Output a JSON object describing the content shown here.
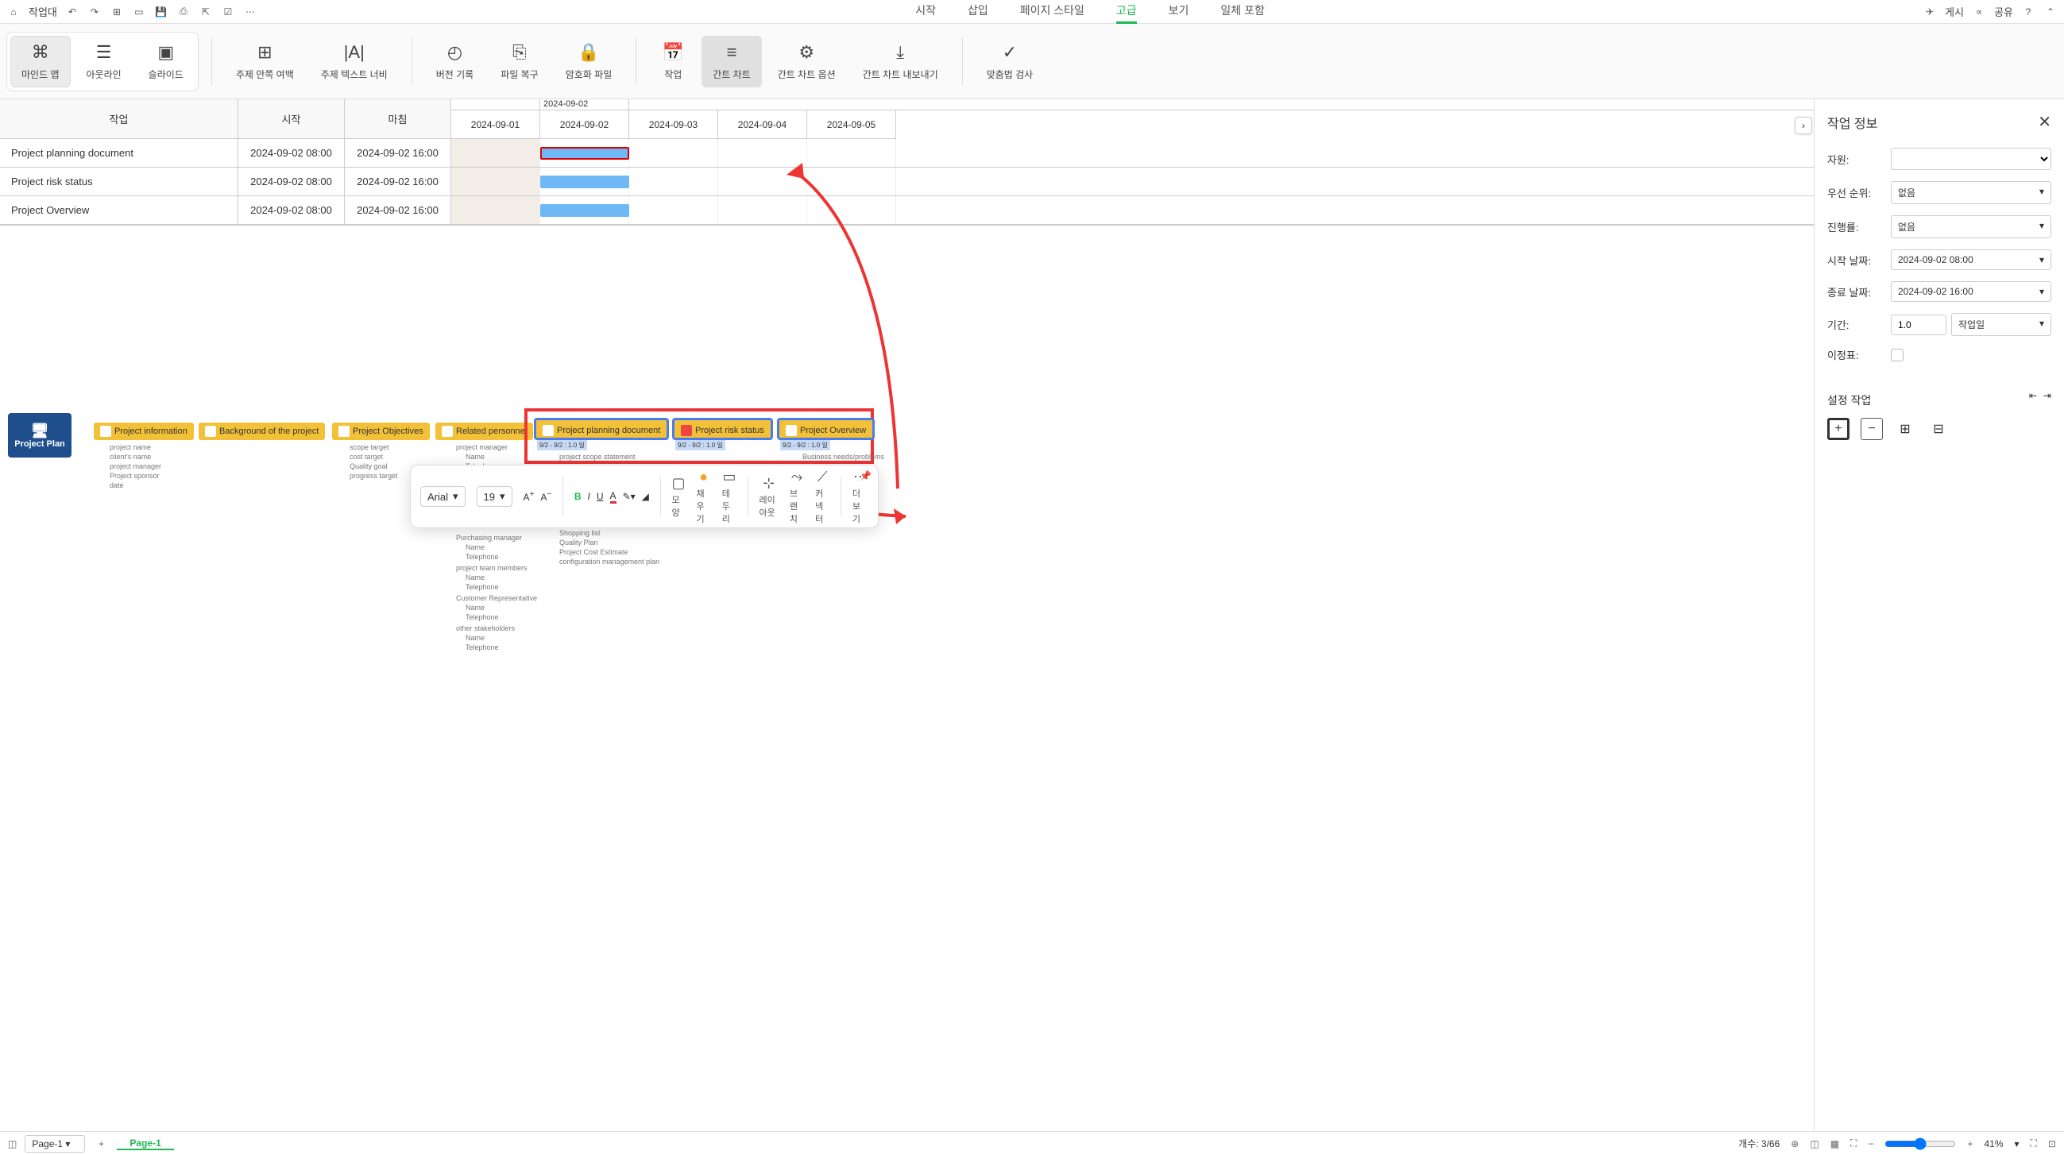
{
  "top": {
    "workspace": "작업대",
    "tabs": [
      "시작",
      "삽입",
      "페이지 스타일",
      "고급",
      "보기",
      "일체 포함"
    ],
    "active_tab": 3,
    "publish": "게시",
    "share": "공유"
  },
  "ribbon": {
    "view_modes": [
      "마인드 맵",
      "아웃라인",
      "슬라이드"
    ],
    "actions": [
      "주제 안쪽 여백",
      "주제 텍스트 너비",
      "버전 기록",
      "파일 복구",
      "암호화 파일",
      "작업",
      "간트 차트",
      "간트 차트 옵션",
      "간트 차트 내보내기",
      "맞춤법 검사"
    ],
    "active_action": 6
  },
  "gantt": {
    "cols": {
      "task": "작업",
      "start": "시작",
      "end": "마침"
    },
    "indicator_date": "2024-09-02",
    "dates": [
      "2024-09-01",
      "2024-09-02",
      "2024-09-03",
      "2024-09-04",
      "2024-09-05"
    ],
    "rows": [
      {
        "task": "Project planning document",
        "start": "2024-09-02 08:00",
        "end": "2024-09-02 16:00"
      },
      {
        "task": "Project risk status",
        "start": "2024-09-02 08:00",
        "end": "2024-09-02 16:00"
      },
      {
        "task": "Project Overview",
        "start": "2024-09-02 08:00",
        "end": "2024-09-02 16:00"
      }
    ]
  },
  "mindmap": {
    "root": "Project Plan",
    "nodes": [
      "Project information",
      "Background of the project",
      "Project Objectives",
      "Related personnel",
      "Project planning document",
      "Project risk status",
      "Project Overview"
    ],
    "info_subs": [
      "project name",
      "client's name",
      "project manager",
      "Project sponsor",
      "date"
    ],
    "obj_subs": [
      "scope target",
      "cost target",
      "Quality goal",
      "progress target"
    ],
    "pers_subs": [
      "project manager",
      "Name",
      "Telephone",
      "Purchasing manager",
      "Name",
      "Telephone",
      "project team members",
      "Name",
      "Telephone",
      "Customer Representative",
      "Name",
      "Telephone",
      "other stakeholders",
      "Name",
      "Telephone"
    ],
    "plan_subs": [
      "project scope statement",
      "Shopping list",
      "Quality Plan",
      "Project Cost Estimate",
      "configuration management plan"
    ],
    "overview_subs": [
      "Business needs/problems"
    ],
    "task_date": "9/2 - 9/2 : 1.0 일"
  },
  "float": {
    "font": "Arial",
    "size": "19",
    "labels": [
      "모양",
      "채우기",
      "테두리",
      "레이아웃",
      "브랜치",
      "커넥터",
      "더 보기"
    ]
  },
  "panel": {
    "title": "작업 정보",
    "resource_label": "자원:",
    "priority_label": "우선 순위:",
    "priority_value": "없음",
    "progress_label": "진행률:",
    "progress_value": "없음",
    "start_label": "시작 날짜:",
    "start_value": "2024-09-02  08:00",
    "end_label": "종료 날짜:",
    "end_value": "2024-09-02  16:00",
    "duration_label": "기간:",
    "duration_value": "1.0",
    "duration_unit": "작업일",
    "milestone_label": "이정표:",
    "section2": "설정 작업"
  },
  "status": {
    "page_select": "Page-1",
    "page_tab": "Page-1",
    "count_label": "개수: 3/66",
    "zoom": "41%"
  }
}
